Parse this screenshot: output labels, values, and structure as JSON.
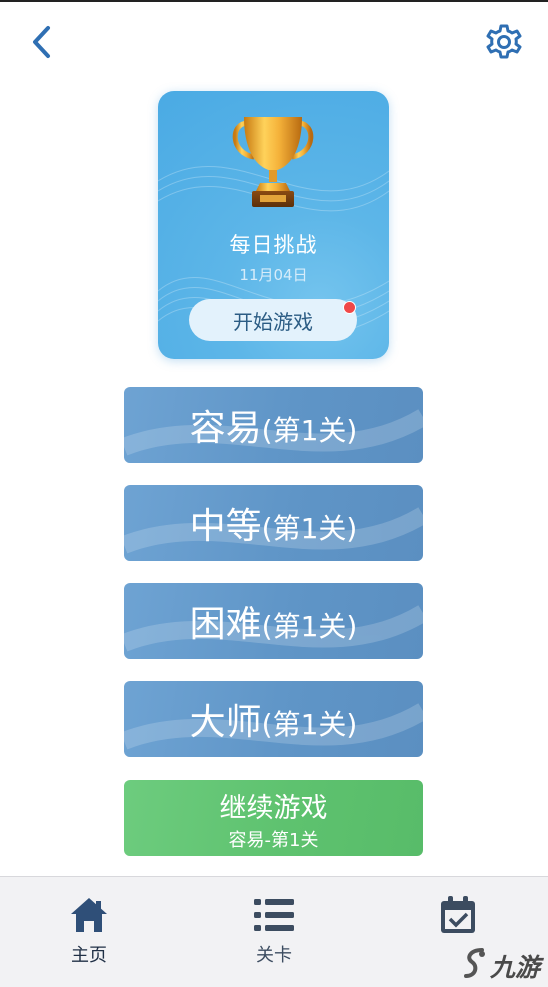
{
  "daily_challenge": {
    "title": "每日挑战",
    "date": "11月04日",
    "start_label": "开始游戏"
  },
  "levels": [
    {
      "name": "容易",
      "stage": "(第1关)"
    },
    {
      "name": "中等",
      "stage": "(第1关)"
    },
    {
      "name": "困难",
      "stage": "(第1关)"
    },
    {
      "name": "大师",
      "stage": "(第1关)"
    }
  ],
  "continue": {
    "title": "继续游戏",
    "subtitle": "容易-第1关"
  },
  "bottom_nav": [
    {
      "label": "主页",
      "icon": "home-icon",
      "active": true
    },
    {
      "label": "关卡",
      "icon": "list-icon",
      "active": false
    },
    {
      "label": "",
      "icon": "calendar-check-icon",
      "active": false
    }
  ],
  "watermark": {
    "text": "九游"
  },
  "colors": {
    "accent": "#2f6fb3",
    "level_button": "#6399cb",
    "continue_button": "#5ec26f",
    "daily_card": "#5db6e8",
    "nav_active": "#2f4f78",
    "nav_inactive": "#3c4c60"
  }
}
